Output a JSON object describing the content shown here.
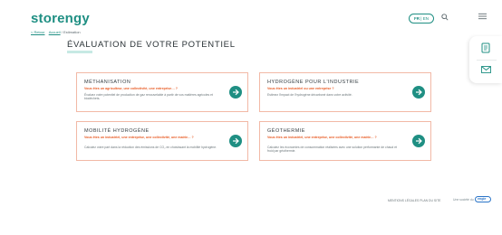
{
  "header": {
    "logo": "storengy",
    "lang_active": "FR",
    "lang_other": "EN",
    "icons": {
      "search": "search-icon",
      "menu": "menu-icon"
    }
  },
  "breadcrumb": {
    "back": "< Retour",
    "home": "Accueil",
    "separator": " / ",
    "current": "Estimation"
  },
  "page": {
    "title": "ÉVALUATION DE VOTRE POTENTIEL"
  },
  "right_rail": {
    "icons": [
      "document-icon",
      "mail-icon"
    ]
  },
  "cards": [
    {
      "title": "MÉTHANISATION",
      "question": "Vous êtes un agriculteur, une collectivité, une entreprise… ?",
      "description": "Évaluez votre potentiel de production de gaz renouvelable à partir de vos matières agricoles et biodéchets."
    },
    {
      "title": "HYDROGÈNE POUR L'INDUSTRIE",
      "question": "Vous êtes un industriel ou une entreprise ?",
      "description": "Estimez l'impact de l'hydrogène décarboné dans votre activité."
    },
    {
      "title": "MOBILITÉ HYDROGÈNE",
      "question": "Vous êtes un industriel, une entreprise, une collectivité, une mairie… ?",
      "description": "Calculez votre part dans la réduction des émissions de CO₂ en choisissant la mobilité hydrogène."
    },
    {
      "title": "GÉOTHERMIE",
      "question": "Vous êtes un industriel, une entreprise, une collectivité, une mairie… ?",
      "description": "Calculez les économies de consommation réalisées avec une solution performante de chaud et froid par géothermie."
    }
  ],
  "footer": {
    "legal": "MENTIONS LÉGALES   PLAN DU SITE",
    "brand_prefix": "Une société du",
    "brand": "engie"
  },
  "colors": {
    "accent": "#1f8f83",
    "highlight": "#e85b24",
    "card_border": "#f2b9a6"
  }
}
